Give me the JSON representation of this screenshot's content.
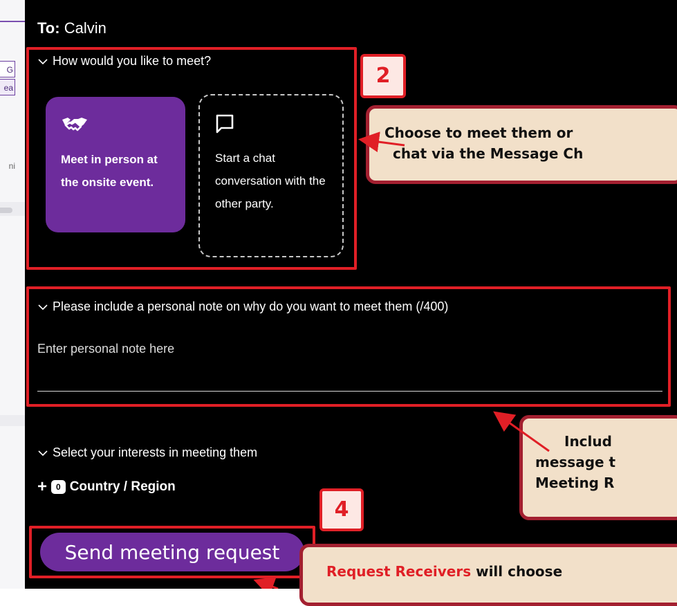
{
  "background_page": {
    "chip_1": "G",
    "chip_2": "ea",
    "hint": "ni"
  },
  "modal": {
    "to_label": "To:",
    "to_name": "Calvin",
    "meet_section": {
      "heading": "How would you like to meet?",
      "options": [
        {
          "icon": "handshake-icon",
          "label": "Meet in person at the onsite event.",
          "selected": true
        },
        {
          "icon": "chat-bubble-icon",
          "label": "Start a chat conversation with the other party.",
          "selected": false
        }
      ]
    },
    "note_section": {
      "heading": "Please include a personal note on why do you want to meet them (/400)",
      "placeholder": "Enter personal note here"
    },
    "interests_section": {
      "heading": "Select your interests in meeting them",
      "add_icon": "plus-icon",
      "count": "0",
      "label": "Country / Region"
    },
    "send_button": "Send meeting request"
  },
  "annotations": {
    "step_2": "2",
    "step_4": "4",
    "callout_1": {
      "line1": "Choose to meet them or",
      "line2": "chat via the Message Ch"
    },
    "callout_2": {
      "line1": "Includ",
      "line2": "message t",
      "line3": "Meeting R"
    },
    "callout_3": {
      "highlight": "Request Receivers",
      "rest": " will choose"
    }
  },
  "colors": {
    "accent_purple": "#6d2c9c",
    "annotation_red": "#e01f26",
    "callout_fill": "#f2e0c9",
    "callout_border": "#a32030"
  }
}
